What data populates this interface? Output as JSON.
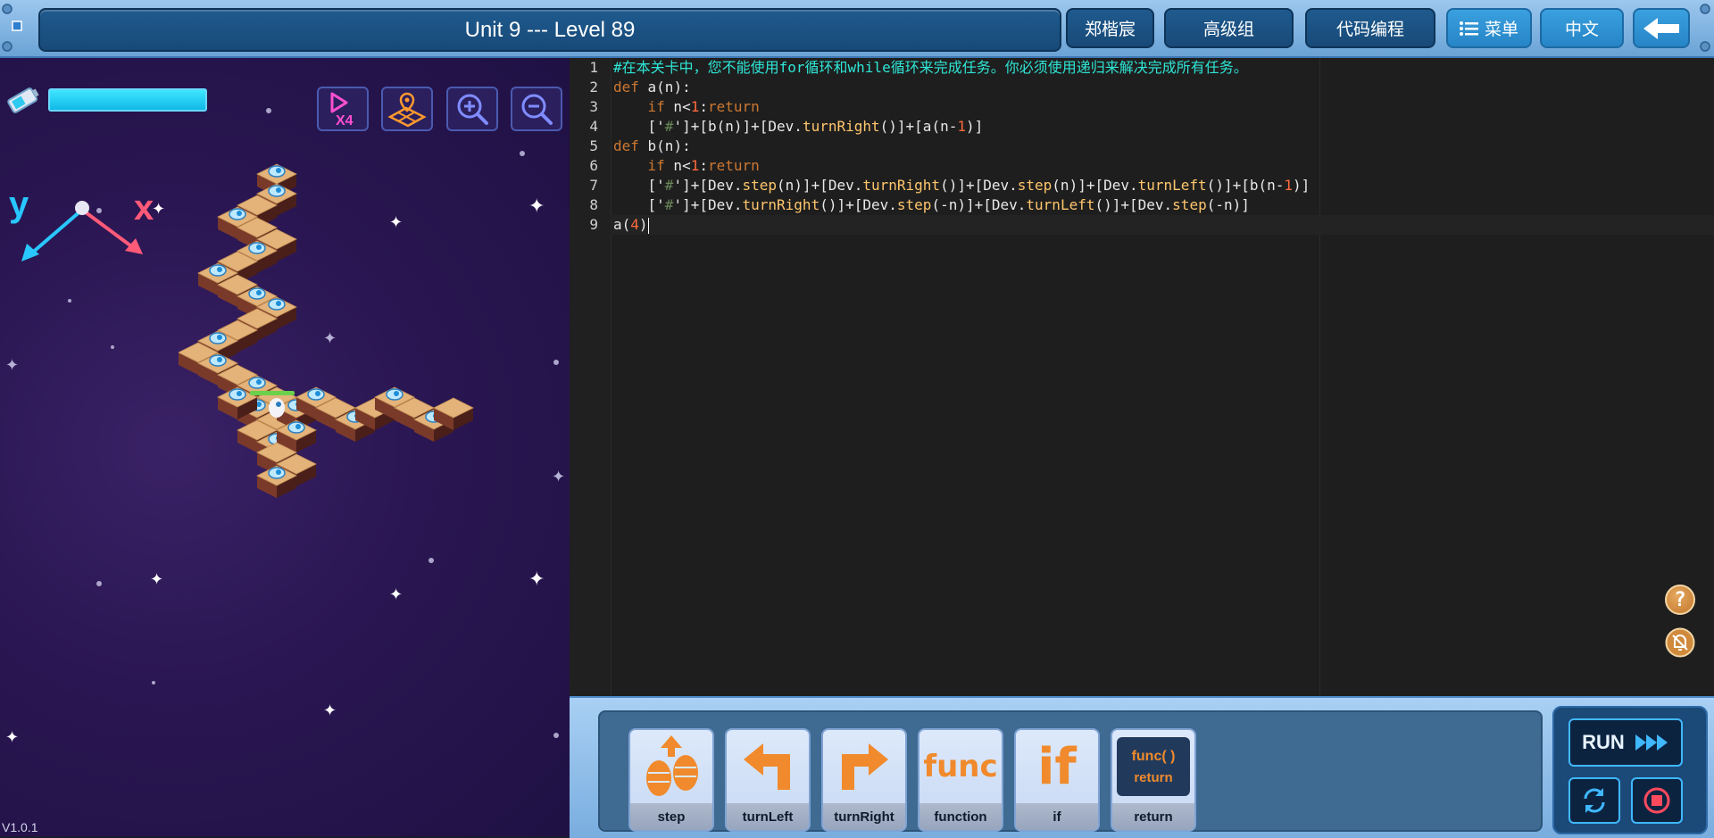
{
  "header": {
    "level_title": "Unit 9 --- Level 89",
    "user_name": "郑楷宸",
    "group": "高级组",
    "mode": "代码编程",
    "menu_label": "菜单",
    "language": "中文",
    "back_icon": "arrow-left-icon"
  },
  "game": {
    "energy_level": 1.0,
    "axis_x_label": "x",
    "axis_y_label": "y",
    "tools": [
      "speed-x4-icon",
      "map-reset-icon",
      "zoom-in-icon",
      "zoom-out-icon"
    ],
    "speed_label": "X4",
    "version": "V1.0.1"
  },
  "editor": {
    "line_numbers": [
      "1",
      "2",
      "3",
      "4",
      "5",
      "6",
      "7",
      "8",
      "9"
    ],
    "comment": "#在本关卡中，您不能使用for循环和while循环来完成任务。你必须使用递归来解决完成所有任务。",
    "code": {
      "l2": [
        "def",
        " a(n):"
      ],
      "l3": [
        "    ",
        "if",
        " n<",
        "1",
        ":",
        "return"
      ],
      "l4": [
        "    ['",
        "#",
        "']+[b(n)]+[Dev.",
        "turnRight",
        "()]+[a(n-",
        "1",
        ")]"
      ],
      "l5": [
        "def",
        " b(n):"
      ],
      "l6": [
        "    ",
        "if",
        " n<",
        "1",
        ":",
        "return"
      ],
      "l7": [
        "    ['",
        "#",
        "']+[Dev.",
        "step",
        "(n)]+[Dev.",
        "turnRight",
        "()]+[Dev.",
        "step",
        "(n)]+[Dev.",
        "turnLeft",
        "()]+[b(n-",
        "1",
        ")]"
      ],
      "l8": [
        "    ['",
        "#",
        "']+[Dev.",
        "turnRight",
        "()]+[Dev.",
        "step",
        "(-n)]+[Dev.",
        "turnLeft",
        "()]+[Dev.",
        "step",
        "(-n)]"
      ],
      "l9": [
        "a(",
        "4",
        ")"
      ]
    },
    "help_icon": "help-icon",
    "mute_icon": "bell-mute-icon"
  },
  "blocks": [
    {
      "label": "step",
      "icon": "step-icon"
    },
    {
      "label": "turnLeft",
      "icon": "turn-left-icon"
    },
    {
      "label": "turnRight",
      "icon": "turn-right-icon"
    },
    {
      "label": "function",
      "icon": "function-icon",
      "icon_text": "func"
    },
    {
      "label": "if",
      "icon": "if-icon",
      "icon_text": "if"
    },
    {
      "label": "return",
      "icon": "return-icon",
      "icon_text": "func( )",
      "icon_text2": "return"
    }
  ],
  "run_controls": {
    "run_label": "RUN",
    "reset_icon": "reset-icon",
    "stop_icon": "stop-icon"
  },
  "colors": {
    "accent": "#3aa0df",
    "energy": "#3fe6ff",
    "comment": "#2ee6d6",
    "keyword": "#cc7832",
    "number": "#ff6b3d",
    "block_icon": "#f08a2c"
  }
}
